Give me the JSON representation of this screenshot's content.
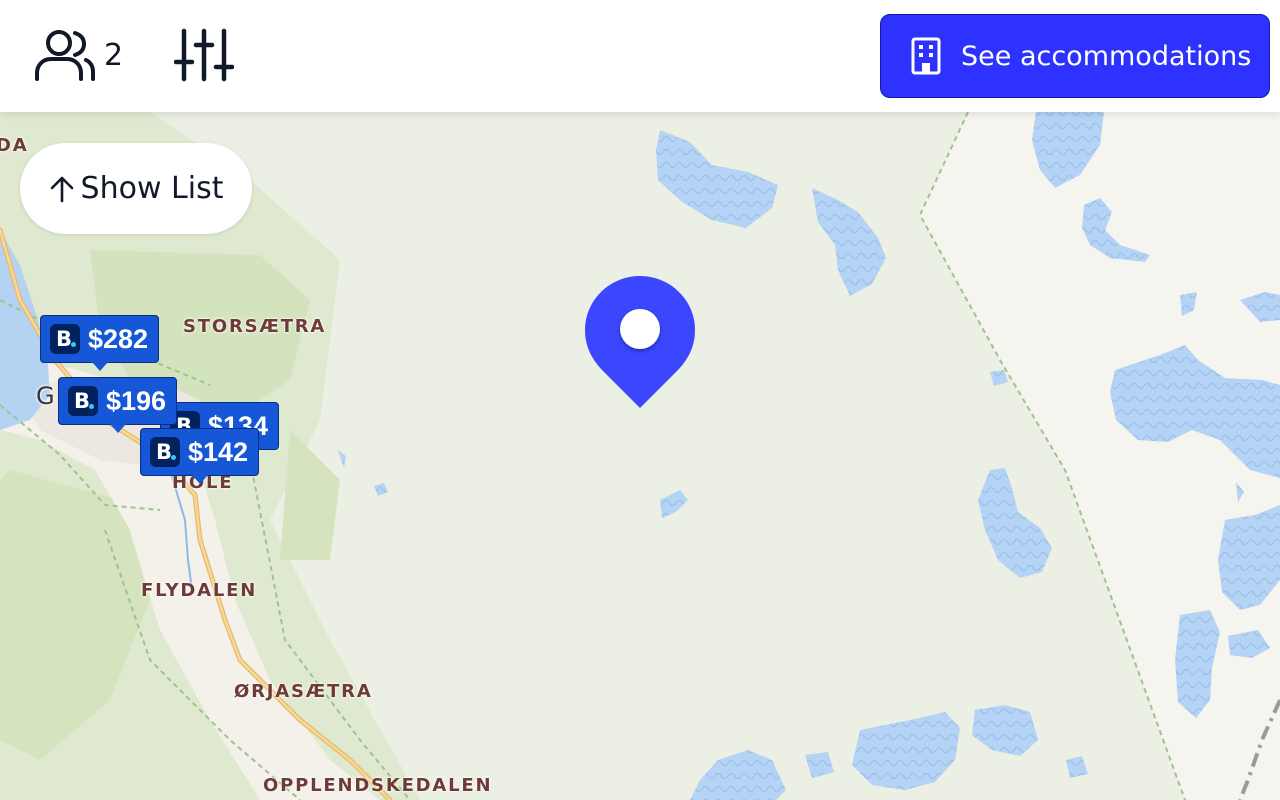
{
  "header": {
    "guests_icon": "users-icon",
    "guest_count": "2",
    "filters_icon": "sliders-icon",
    "accommodations_button": {
      "icon": "building-icon",
      "label": "See accommodations"
    }
  },
  "show_list": {
    "icon": "arrow-up-icon",
    "label": "Show List"
  },
  "place_labels": {
    "corner": "DA",
    "gol_fragment": "G",
    "storsaetra": "STORSÆTRA",
    "hole": "HOLE",
    "flydalen": "FLYDALEN",
    "orjasaetra": "ØRJASÆTRA",
    "opplendskedalen": "OPPLENDSKEDALEN"
  },
  "price_markers": [
    {
      "logo_letter": "B",
      "price": "$282"
    },
    {
      "logo_letter": "B",
      "price": "$196"
    },
    {
      "logo_letter": "B",
      "price": "$134"
    },
    {
      "logo_letter": "B",
      "price": "$142"
    }
  ],
  "location_pin": {
    "icon": "map-pin-icon"
  },
  "colors": {
    "accent": "#2e32ff",
    "pin": "#3a47ff",
    "marker": "#1557d6",
    "map_land": "#ecefe3",
    "water": "#b4d3f3",
    "forest": "#dbe8c9",
    "urban": "#f6f4ef",
    "road": "#f5c97b"
  }
}
